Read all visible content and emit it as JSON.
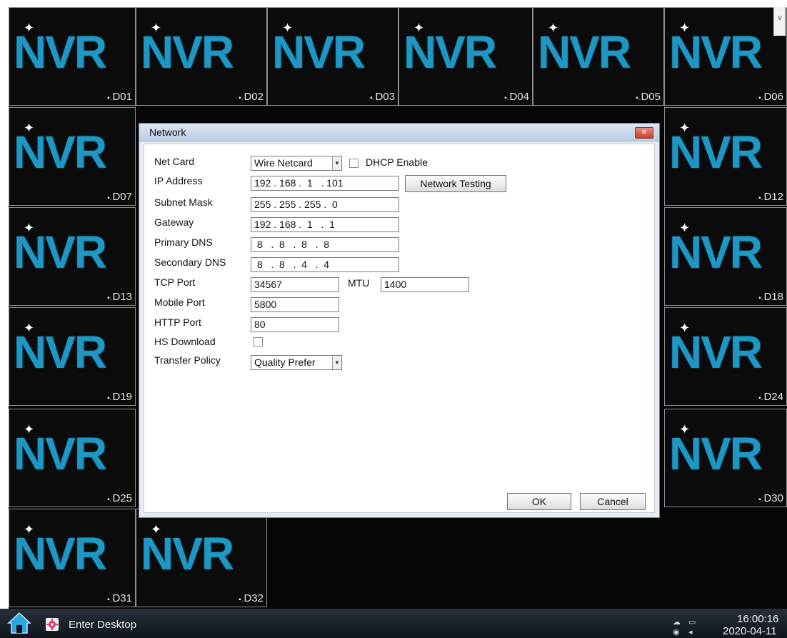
{
  "tiles": [
    {
      "logo": "NVR",
      "label": "D01"
    },
    {
      "logo": "NVR",
      "label": "D02"
    },
    {
      "logo": "NVR",
      "label": "D03"
    },
    {
      "logo": "NVR",
      "label": "D04"
    },
    {
      "logo": "NVR",
      "label": "D05"
    },
    {
      "logo": "NVR",
      "label": "D06"
    },
    {
      "logo": "NVR",
      "label": "D07"
    },
    {
      "logo": "NVR",
      "label": "D12"
    },
    {
      "logo": "NVR",
      "label": "D13"
    },
    {
      "logo": "NVR",
      "label": "D18"
    },
    {
      "logo": "NVR",
      "label": "D19"
    },
    {
      "logo": "NVR",
      "label": "D24"
    },
    {
      "logo": "NVR",
      "label": "D25"
    },
    {
      "logo": "NVR",
      "label": "D30"
    },
    {
      "logo": "NVR",
      "label": "D31"
    },
    {
      "logo": "NVR",
      "label": "D32"
    }
  ],
  "dialog": {
    "title": "Network",
    "close_icon": "close-icon",
    "labels": {
      "net_card": "Net Card",
      "dhcp": "DHCP Enable",
      "ip": "IP Address",
      "subnet": "Subnet Mask",
      "gateway": "Gateway",
      "primary_dns": "Primary DNS",
      "secondary_dns": "Secondary DNS",
      "tcp_port": "TCP Port",
      "mtu": "MTU",
      "mobile_port": "Mobile Port",
      "http_port": "HTTP Port",
      "hs_download": "HS Download",
      "transfer_policy": "Transfer Policy"
    },
    "values": {
      "net_card": "Wire Netcard",
      "ip": "192 . 168 .  1   . 101",
      "subnet": "255 . 255 . 255 .  0",
      "gateway": "192 . 168 .  1   .  1",
      "primary_dns": " 8   .  8   .  8   .  8",
      "secondary_dns": " 8   .  8   .  4   .  4",
      "tcp_port": "34567",
      "mtu": "1400",
      "mobile_port": "5800",
      "http_port": "80",
      "transfer_policy": "Quality Prefer"
    },
    "checkboxes": {
      "dhcp_enabled": false,
      "hs_download": false
    },
    "buttons": {
      "network_testing": "Network Testing",
      "ok": "OK",
      "cancel": "Cancel"
    }
  },
  "taskbar": {
    "home_icon": "home-icon",
    "desktop_icon": "desktop-gear-icon",
    "enter_desktop": "Enter Desktop",
    "time": "16:00:16",
    "date": "2020-04-11"
  },
  "colors": {
    "logo_blue": "#1e97c4",
    "tile_bg": "#0b0b0b",
    "dialog_title_bg": "#bccde4"
  }
}
